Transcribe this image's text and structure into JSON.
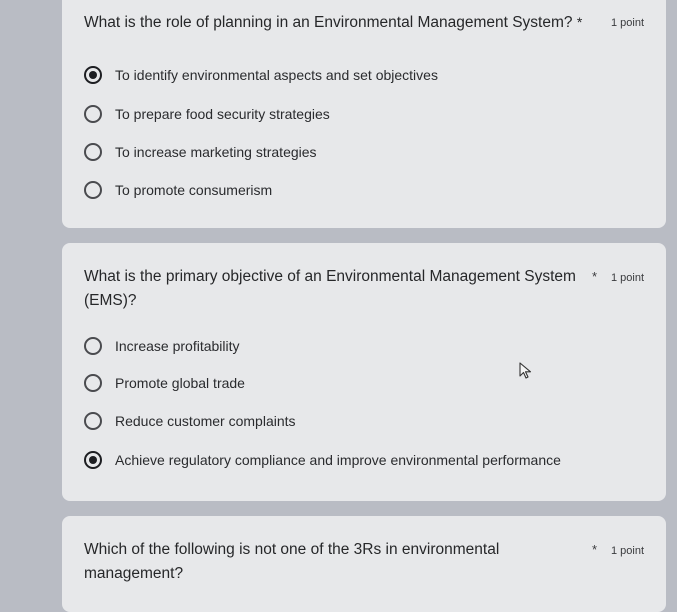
{
  "questions": [
    {
      "title": "What is the role of planning in an Environmental Management System?",
      "required_mark": "*",
      "points": "1 point",
      "options": [
        {
          "label": "To identify environmental aspects and set objectives",
          "selected": true
        },
        {
          "label": "To prepare food security strategies",
          "selected": false
        },
        {
          "label": "To increase marketing strategies",
          "selected": false
        },
        {
          "label": "To promote consumerism",
          "selected": false
        }
      ]
    },
    {
      "title_line1": "What is the primary objective of an Environmental Management System",
      "title_line2": "(EMS)?",
      "required_mark": "*",
      "points": "1 point",
      "options": [
        {
          "label": "Increase profitability",
          "selected": false
        },
        {
          "label": "Promote global trade",
          "selected": false
        },
        {
          "label": "Reduce customer complaints",
          "selected": false
        },
        {
          "label": "Achieve regulatory compliance and improve environmental performance",
          "selected": true
        }
      ]
    },
    {
      "title_line1": "Which of the following is not one of the 3Rs in environmental",
      "title_line2": "management?",
      "required_mark": "*",
      "points": "1 point"
    }
  ]
}
